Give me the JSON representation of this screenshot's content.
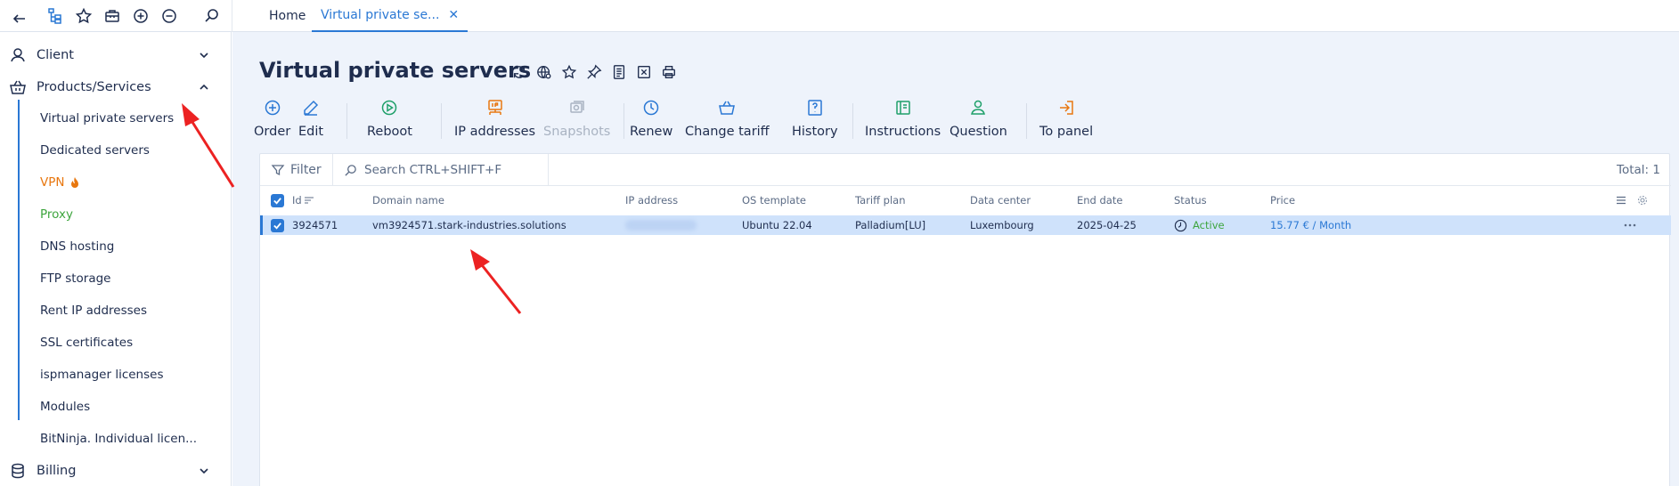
{
  "tabs": [
    {
      "label": "Home"
    },
    {
      "label": "Virtual private se...",
      "close": "✕"
    }
  ],
  "sidebar": {
    "groups": [
      {
        "label": "Client"
      },
      {
        "label": "Products/Services"
      },
      {
        "label": "Billing"
      }
    ],
    "items": [
      {
        "label": "Virtual private servers"
      },
      {
        "label": "Dedicated servers"
      },
      {
        "label": "VPN"
      },
      {
        "label": "Proxy"
      },
      {
        "label": "DNS hosting"
      },
      {
        "label": "FTP storage"
      },
      {
        "label": "Rent IP addresses"
      },
      {
        "label": "SSL certificates"
      },
      {
        "label": "ispmanager licenses"
      },
      {
        "label": "Modules"
      },
      {
        "label": "BitNinja. Individual licen..."
      }
    ]
  },
  "page": {
    "title": "Virtual private servers"
  },
  "toolbar": {
    "buttons": [
      {
        "label": "Order"
      },
      {
        "label": "Edit"
      },
      {
        "label": "Reboot"
      },
      {
        "label": "IP addresses"
      },
      {
        "label": "Snapshots"
      },
      {
        "label": "Renew"
      },
      {
        "label": "Change tariff"
      },
      {
        "label": "History"
      },
      {
        "label": "Instructions"
      },
      {
        "label": "Question"
      },
      {
        "label": "To panel"
      }
    ]
  },
  "filterbar": {
    "filter_label": "Filter",
    "search_placeholder": "Search CTRL+SHIFT+F",
    "total": "Total: 1"
  },
  "table": {
    "columns": [
      "Id",
      "Domain name",
      "IP address",
      "OS template",
      "Tariff plan",
      "Data center",
      "End date",
      "Status",
      "Price"
    ],
    "rows": [
      {
        "id": "3924571",
        "domain": "vm3924571.stark-industries.solutions",
        "os": "Ubuntu 22.04",
        "tariff": "Palladium[LU]",
        "datacenter": "Luxembourg",
        "end_date": "2025-04-25",
        "status": "Active",
        "price": "15.77 € / Month"
      }
    ]
  },
  "colors": {
    "accent": "#2a78d4",
    "text": "#1f2d4e",
    "muted": "#5b6b85",
    "active_green": "#3ea53e",
    "vpn_orange": "#e8770f",
    "selected_row": "#cfe2fb",
    "annotation_red": "#ec2222"
  }
}
